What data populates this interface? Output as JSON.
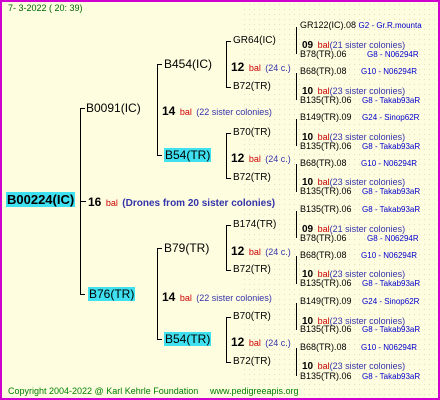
{
  "header": {
    "date": "7-  3-2022 ( 20: 39)"
  },
  "footer": {
    "copyright": "Copyright 2004-2022 @ Karl Kehrle Foundation",
    "site": "www.pedigreeapis.org"
  },
  "root": {
    "name": "B00224(IC)",
    "count": "16",
    "bal": "bal",
    "sisters": "(Drones from 20 sister colonies)"
  },
  "gen1": {
    "top": {
      "name": "B0091(IC)",
      "count": "14",
      "bal": "bal",
      "sisters": "(22 sister colonies)"
    },
    "bottom": {
      "name": "B76(TR)",
      "count": "14",
      "bal": "bal",
      "sisters": "(22 sister colonies)"
    }
  },
  "gen2": {
    "a": {
      "name": "B454(IC)",
      "count": "12",
      "bal": "bal",
      "sisters": "(24 c.)"
    },
    "b": {
      "name": "B54(TR)",
      "count": "12",
      "bal": "bal",
      "sisters": "(24 c.)"
    },
    "c": {
      "name": "B79(TR)",
      "count": "12",
      "bal": "bal",
      "sisters": "(24 c.)"
    },
    "d": {
      "name": "B54(TR)",
      "count": "12",
      "bal": "bal",
      "sisters": "(24 c.)"
    }
  },
  "gen3": [
    {
      "name": "GR64(IC)",
      "count": "09",
      "bal": "bal",
      "sisters": "(21 sister colonies)"
    },
    {
      "name": "B72(TR)",
      "count": "10",
      "bal": "bal",
      "sisters": "(23 sister colonies)"
    },
    {
      "name": "B70(TR)",
      "count": "10",
      "bal": "bal",
      "sisters": "(23 sister colonies)"
    },
    {
      "name": "B72(TR)",
      "count": "10",
      "bal": "bal",
      "sisters": "(23 sister colonies)"
    },
    {
      "name": "B174(TR)",
      "count": "09",
      "bal": "bal",
      "sisters": "(21 sister colonies)"
    },
    {
      "name": "B72(TR)",
      "count": "10",
      "bal": "bal",
      "sisters": "(23 sister colonies)"
    },
    {
      "name": "B70(TR)",
      "count": "10",
      "bal": "bal",
      "sisters": "(23 sister colonies)"
    },
    {
      "name": "B72(TR)",
      "count": "10",
      "bal": "bal",
      "sisters": "(23 sister colonies)"
    }
  ],
  "gen4": [
    {
      "name": "GR122(IC).08",
      "src": "G2 - Gr.R.mounta"
    },
    {
      "name": "B78(TR).06",
      "src": "G8 - N06294R"
    },
    {
      "name": "B68(TR).08",
      "src": "G10 - N06294R"
    },
    {
      "name": "B135(TR).06",
      "src": "G8 - Takab93aR"
    },
    {
      "name": "B149(TR).09",
      "src": "G24 - Sinop62R"
    },
    {
      "name": "B135(TR).06",
      "src": "G8 - Takab93aR"
    },
    {
      "name": "B68(TR).08",
      "src": "G10 - N06294R"
    },
    {
      "name": "B135(TR).06",
      "src": "G8 - Takab93aR"
    },
    {
      "name": "B135(TR).06",
      "src": "G8 - Takab93aR"
    },
    {
      "name": "B78(TR).06",
      "src": "G8 - N06294R"
    },
    {
      "name": "B68(TR).08",
      "src": "G10 - N06294R"
    },
    {
      "name": "B135(TR).06",
      "src": "G8 - Takab93aR"
    },
    {
      "name": "B149(TR).09",
      "src": "G24 - Sinop62R"
    },
    {
      "name": "B135(TR).06",
      "src": "G8 - Takab93aR"
    },
    {
      "name": "B68(TR).08",
      "src": "G10 - N06294R"
    },
    {
      "name": "B135(TR).06",
      "src": "G8 - Takab93aR"
    }
  ],
  "colors": {
    "border": "#d000d0",
    "background": "#fffde0",
    "highlight": "#3fe0f0",
    "bal": "#cc0000",
    "sisters": "#3333aa"
  }
}
